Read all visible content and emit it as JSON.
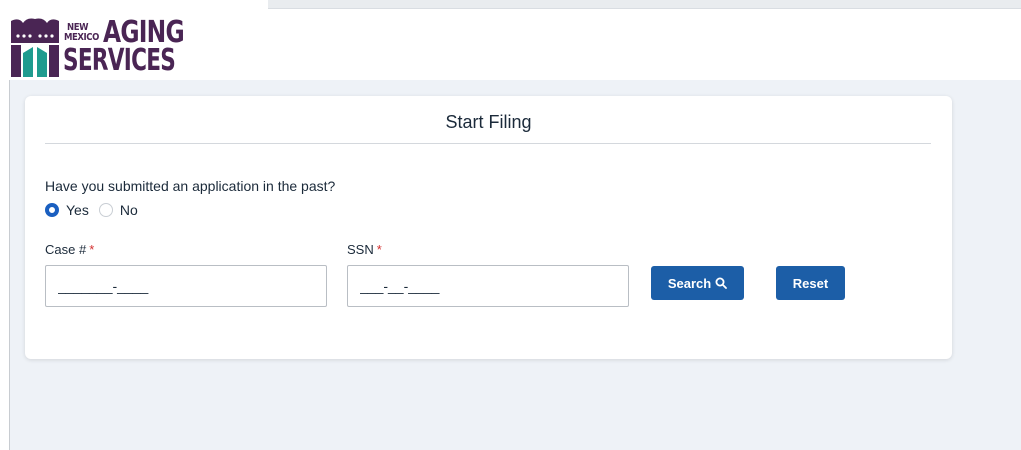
{
  "logo": {
    "line_new": "NEW",
    "line_mexico": "MEXICO",
    "line_aging": "AGING",
    "line_services": "SERVICES",
    "colors": {
      "purple": "#4a2554",
      "teal": "#1f9b8f"
    }
  },
  "form": {
    "title": "Start Filing",
    "question": "Have you submitted an application in the past?",
    "options": [
      {
        "label": "Yes",
        "selected": true
      },
      {
        "label": "No",
        "selected": false
      }
    ],
    "case_label": "Case #",
    "ssn_label": "SSN",
    "required_mark": "*",
    "case_placeholder": "_______-____",
    "ssn_placeholder": "___-__-____",
    "search_label": "Search",
    "reset_label": "Reset"
  },
  "colors": {
    "primary": "#1c5ea7",
    "radio_selected": "#1a5fc0",
    "required": "#d32f2f",
    "background": "#eef2f7"
  },
  "icons": {
    "search": "search-icon"
  }
}
